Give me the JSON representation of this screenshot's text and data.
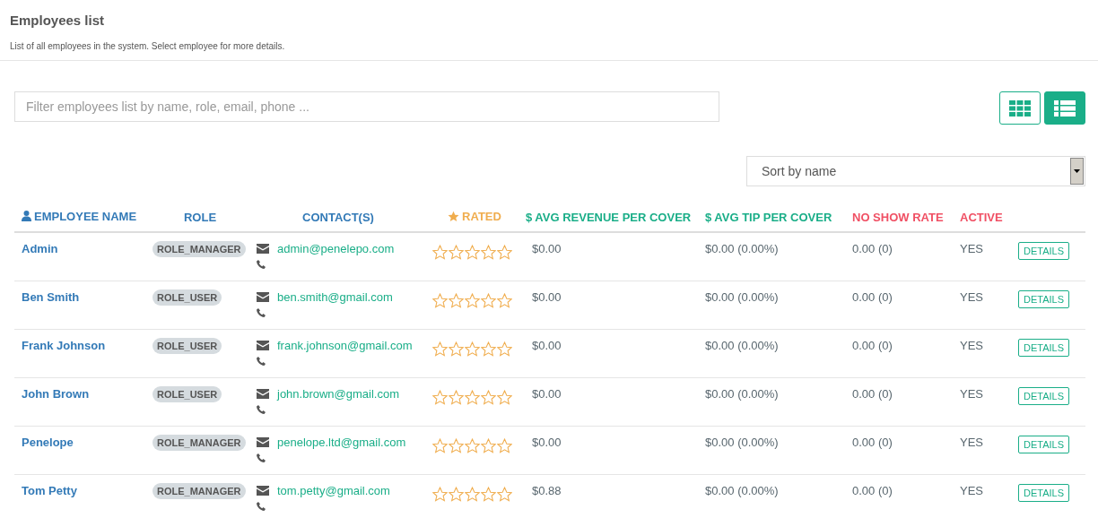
{
  "page": {
    "title": "Employees list",
    "subtitle": "List of all employees in the system. Select employee for more details."
  },
  "filter": {
    "placeholder": "Filter employees list by name, role, email, phone ..."
  },
  "view_toggle": [
    {
      "kind": "grid",
      "selected": false
    },
    {
      "kind": "list",
      "selected": true
    }
  ],
  "sort": {
    "value": "Sort by name"
  },
  "table": {
    "columns": [
      {
        "label": "EMPLOYEE NAME",
        "kind": "person",
        "color": "#337ab7"
      },
      {
        "label": "ROLE",
        "kind": "plain",
        "color": "#337ab7"
      },
      {
        "label": "CONTACT(S)",
        "kind": "plain",
        "color": "#337ab7"
      },
      {
        "label": "RATED",
        "kind": "star",
        "color": "#f0ad4e"
      },
      {
        "label": "$ AVG REVENUE PER COVER",
        "kind": "plain",
        "color": "#1aae88"
      },
      {
        "label": "$ AVG TIP PER COVER",
        "kind": "plain",
        "color": "#1aae88"
      },
      {
        "label": "NO SHOW RATE",
        "kind": "plain",
        "color": "#f05064"
      },
      {
        "label": "ACTIVE",
        "kind": "plain",
        "color": "#f05064"
      }
    ],
    "rows": [
      {
        "name": "Admin",
        "role": "ROLE_MANAGER",
        "email": "admin@penelepo.com",
        "stars": 0,
        "revenue": "$0.00",
        "tip": "$0.00 (0.00%)",
        "no_show": "0.00 (0)",
        "active": "YES",
        "action": "DETAILS"
      },
      {
        "name": "Ben Smith",
        "role": "ROLE_USER",
        "email": "ben.smith@gmail.com",
        "stars": 0,
        "revenue": "$0.00",
        "tip": "$0.00 (0.00%)",
        "no_show": "0.00 (0)",
        "active": "YES",
        "action": "DETAILS"
      },
      {
        "name": "Frank Johnson",
        "role": "ROLE_USER",
        "email": "frank.johnson@gmail.com",
        "stars": 0,
        "revenue": "$0.00",
        "tip": "$0.00 (0.00%)",
        "no_show": "0.00 (0)",
        "active": "YES",
        "action": "DETAILS"
      },
      {
        "name": "John Brown",
        "role": "ROLE_USER",
        "email": "john.brown@gmail.com",
        "stars": 0,
        "revenue": "$0.00",
        "tip": "$0.00 (0.00%)",
        "no_show": "0.00 (0)",
        "active": "YES",
        "action": "DETAILS"
      },
      {
        "name": "Penelope",
        "role": "ROLE_MANAGER",
        "email": "penelope.ltd@gmail.com",
        "stars": 0,
        "revenue": "$0.00",
        "tip": "$0.00 (0.00%)",
        "no_show": "0.00 (0)",
        "active": "YES",
        "action": "DETAILS"
      },
      {
        "name": "Tom Petty",
        "role": "ROLE_MANAGER",
        "email": "tom.petty@gmail.com",
        "stars": 0,
        "revenue": "$0.88",
        "tip": "$0.00 (0.00%)",
        "no_show": "0.00 (0)",
        "active": "YES",
        "action": "DETAILS"
      }
    ]
  }
}
